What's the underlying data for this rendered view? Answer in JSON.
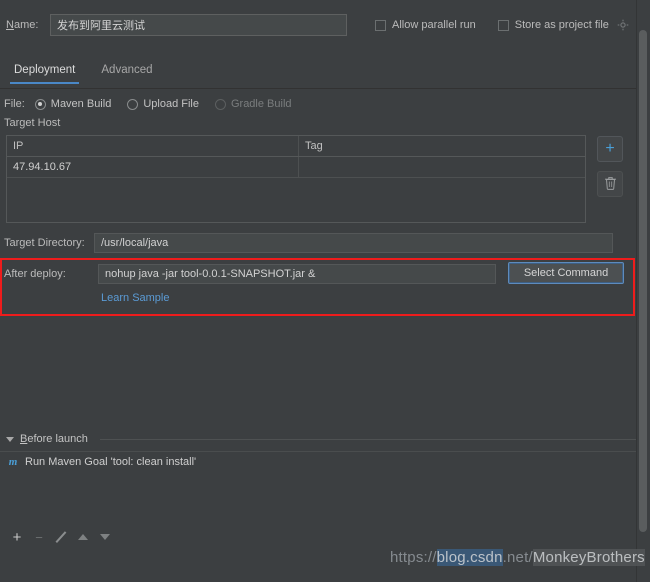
{
  "window": {
    "background_color": "#3c3f41",
    "accent_color": "#4a88c7",
    "highlight_color": "#ee1c1c",
    "link_color": "#5b9bd5"
  },
  "name_row": {
    "label": "Name:",
    "value": "发布到阿里云测试",
    "placeholder": "",
    "checkboxes": [
      {
        "label": "Allow parallel run",
        "checked": false
      },
      {
        "label": "Store as project file",
        "checked": false
      }
    ],
    "gear_icon": "gear-icon"
  },
  "tabs": [
    {
      "label": "Deployment",
      "active": true
    },
    {
      "label": "Advanced",
      "active": false
    }
  ],
  "file_row": {
    "label": "File:",
    "options": [
      {
        "label": "Maven Build",
        "checked": true,
        "disabled": false
      },
      {
        "label": "Upload File",
        "checked": false,
        "disabled": false
      },
      {
        "label": "Gradle Build",
        "checked": false,
        "disabled": true
      }
    ]
  },
  "target_host": {
    "section_label": "Target Host",
    "columns": [
      "IP",
      "Tag"
    ],
    "rows": [
      {
        "ip": "47.94.10.67",
        "tag": ""
      }
    ],
    "buttons": [
      {
        "name": "add-host-button",
        "icon": "plus-icon",
        "glyph": "+"
      },
      {
        "name": "delete-host-button",
        "icon": "trash-icon"
      }
    ]
  },
  "target_directory": {
    "label": "Target Directory:",
    "value": "/usr/local/java",
    "placeholder": ""
  },
  "after_deploy": {
    "label": "After deploy:",
    "value": "nohup java -jar tool-0.0.1-SNAPSHOT.jar &",
    "placeholder": "",
    "select_command_label": "Select Command",
    "learn_sample_label": "Learn Sample"
  },
  "before_launch": {
    "title": "Before launch",
    "expanded": true,
    "items": [
      {
        "icon": "maven-icon",
        "glyph": "m",
        "label": "Run Maven Goal 'tool: clean install'"
      }
    ]
  },
  "bottom_toolbar": {
    "buttons": [
      {
        "name": "add-button",
        "glyph": "+",
        "enabled": true
      },
      {
        "name": "remove-button",
        "glyph": "−",
        "enabled": false
      },
      {
        "name": "edit-button",
        "glyph": "",
        "enabled": false
      },
      {
        "name": "move-up-button",
        "glyph": "",
        "enabled": false
      },
      {
        "name": "move-down-button",
        "glyph": "",
        "enabled": false
      }
    ]
  },
  "watermark": {
    "prefix": "https://",
    "hl1": "blog.csdn",
    "mid": ".net/",
    "hl2": "MonkeyBrothers"
  }
}
